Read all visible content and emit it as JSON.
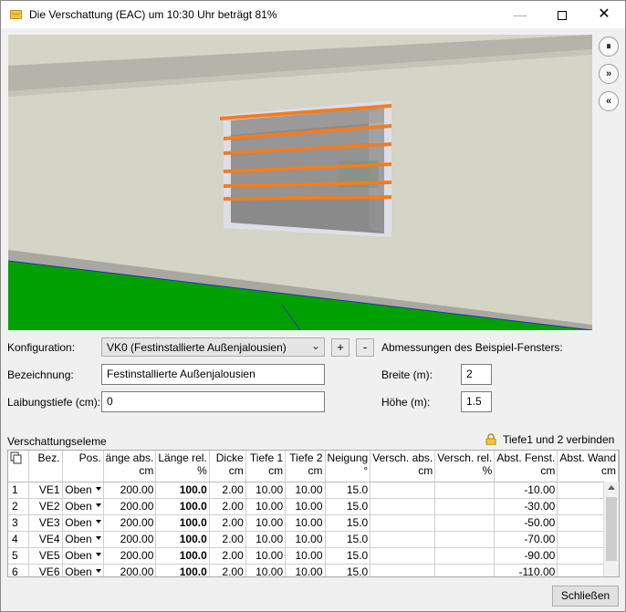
{
  "window": {
    "title": "Die Verschattung (EAC) um 10:30 Uhr beträgt  81%",
    "minimize_icon": "minimize-icon",
    "maximize_icon": "maximize-icon",
    "close_glyph": "✕"
  },
  "scene": {
    "wall_color": "#d4d4c7",
    "ground_color": "#00a000",
    "blade_color": "#f47c20",
    "blade_count": 6
  },
  "playback": {
    "pause": "⏸",
    "forward": "»",
    "rewind": "«"
  },
  "form": {
    "konfiguration_label": "Konfiguration:",
    "konfiguration_value": "VK0 (Festinstallierte Außenjalousien)",
    "add_label": "+",
    "remove_label": "-",
    "bezeichnung_label": "Bezeichnung:",
    "bezeichnung_value": "Festinstallierte Außenjalousien",
    "laibungstiefe_label": "Laibungstiefe (cm):",
    "laibungstiefe_value": "0",
    "abmessungen_label": "Abmessungen des Beispiel-Fensters:",
    "breite_label": "Breite (m):",
    "breite_value": "2",
    "hoehe_label": "Höhe (m):",
    "hoehe_value": "1.5"
  },
  "table": {
    "section_label": "Verschattungseleme",
    "link_label": "Tiefe1 und 2 verbinden",
    "headers": [
      {
        "l1": "",
        "l2": ""
      },
      {
        "l1": "Bez.",
        "l2": ""
      },
      {
        "l1": "Pos.",
        "l2": ""
      },
      {
        "l1": "änge abs.",
        "l2": "cm"
      },
      {
        "l1": "Länge rel.",
        "l2": "%"
      },
      {
        "l1": "Dicke",
        "l2": "cm"
      },
      {
        "l1": "Tiefe 1",
        "l2": "cm"
      },
      {
        "l1": "Tiefe 2",
        "l2": "cm"
      },
      {
        "l1": "Neigung",
        "l2": "°"
      },
      {
        "l1": "Versch. abs.",
        "l2": "cm"
      },
      {
        "l1": "Versch. rel.",
        "l2": "%"
      },
      {
        "l1": "Abst. Fenst.",
        "l2": "cm"
      },
      {
        "l1": "Abst. Wand",
        "l2": "cm"
      }
    ],
    "rows": [
      [
        "1",
        "VE1",
        "Oben",
        "200.00",
        "100.0",
        "2.00",
        "10.00",
        "10.00",
        "15.0",
        "",
        "",
        "-10.00",
        ""
      ],
      [
        "2",
        "VE2",
        "Oben",
        "200.00",
        "100.0",
        "2.00",
        "10.00",
        "10.00",
        "15.0",
        "",
        "",
        "-30.00",
        ""
      ],
      [
        "3",
        "VE3",
        "Oben",
        "200.00",
        "100.0",
        "2.00",
        "10.00",
        "10.00",
        "15.0",
        "",
        "",
        "-50.00",
        ""
      ],
      [
        "4",
        "VE4",
        "Oben",
        "200.00",
        "100.0",
        "2.00",
        "10.00",
        "10.00",
        "15.0",
        "",
        "",
        "-70.00",
        ""
      ],
      [
        "5",
        "VE5",
        "Oben",
        "200.00",
        "100.0",
        "2.00",
        "10.00",
        "10.00",
        "15.0",
        "",
        "",
        "-90.00",
        ""
      ],
      [
        "6",
        "VE6",
        "Oben",
        "200.00",
        "100.0",
        "2.00",
        "10.00",
        "10.00",
        "15.0",
        "",
        "",
        "-110.00",
        ""
      ]
    ]
  },
  "footer": {
    "close_label": "Schließen"
  }
}
